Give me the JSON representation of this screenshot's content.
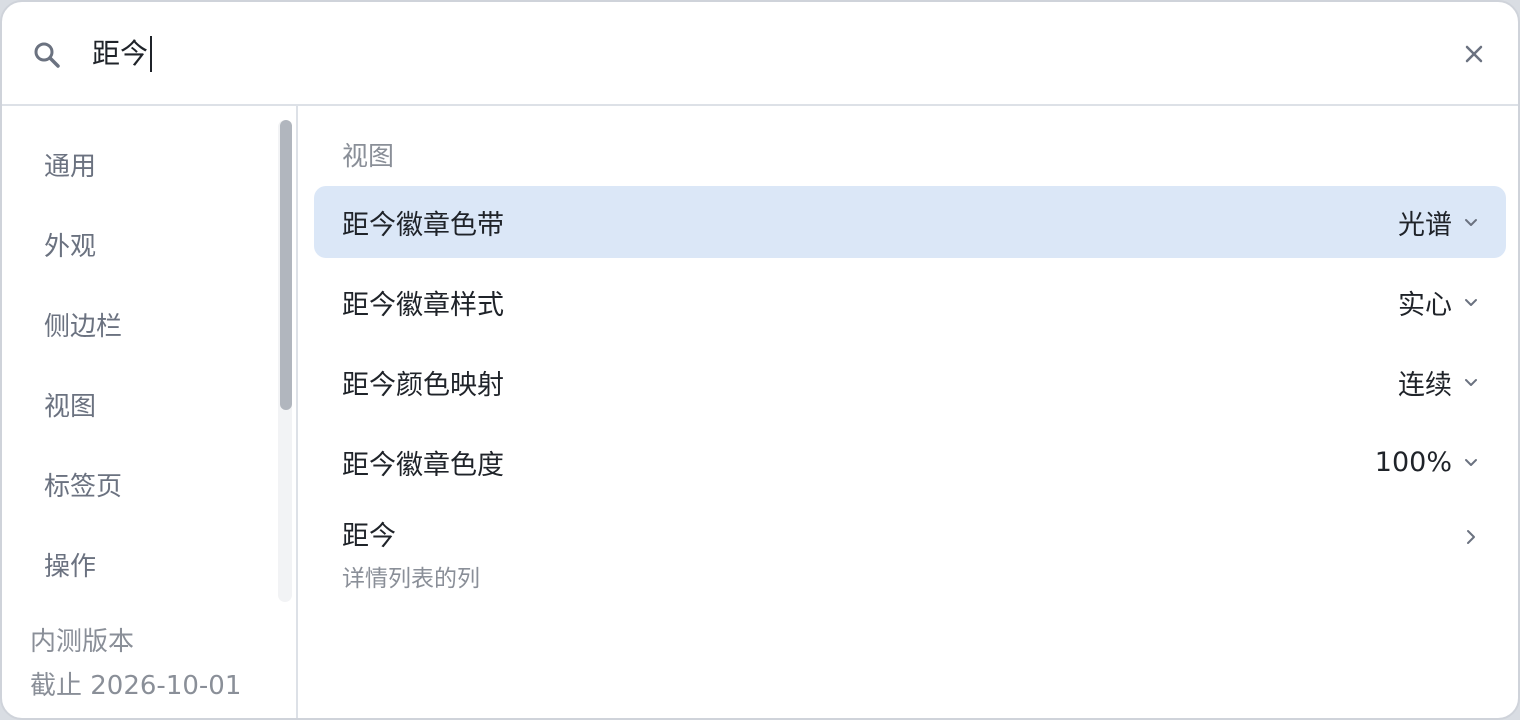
{
  "search": {
    "value": "距今",
    "placeholder": ""
  },
  "sidebar": {
    "items": [
      {
        "label": "通用"
      },
      {
        "label": "外观"
      },
      {
        "label": "侧边栏"
      },
      {
        "label": "视图"
      },
      {
        "label": "标签页"
      },
      {
        "label": "操作"
      }
    ],
    "version_line1": "内测版本",
    "version_line2": "截止 2026-10-01"
  },
  "main": {
    "section_title": "视图",
    "settings": [
      {
        "label": "距今徽章色带",
        "value": "光谱",
        "selected": true
      },
      {
        "label": "距今徽章样式",
        "value": "实心"
      },
      {
        "label": "距今颜色映射",
        "value": "连续"
      },
      {
        "label": "距今徽章色度",
        "value": "100%"
      }
    ],
    "nav_item": {
      "label": "距今",
      "subtitle": "详情列表的列"
    }
  },
  "colors": {
    "selected_row": "#dbe7f7",
    "border": "#dde1e7",
    "muted_text": "#8a8f98"
  },
  "icons": {
    "search": "search-icon",
    "close": "close-icon",
    "dropdown": "chevron-down-icon",
    "nav": "chevron-right-icon"
  }
}
